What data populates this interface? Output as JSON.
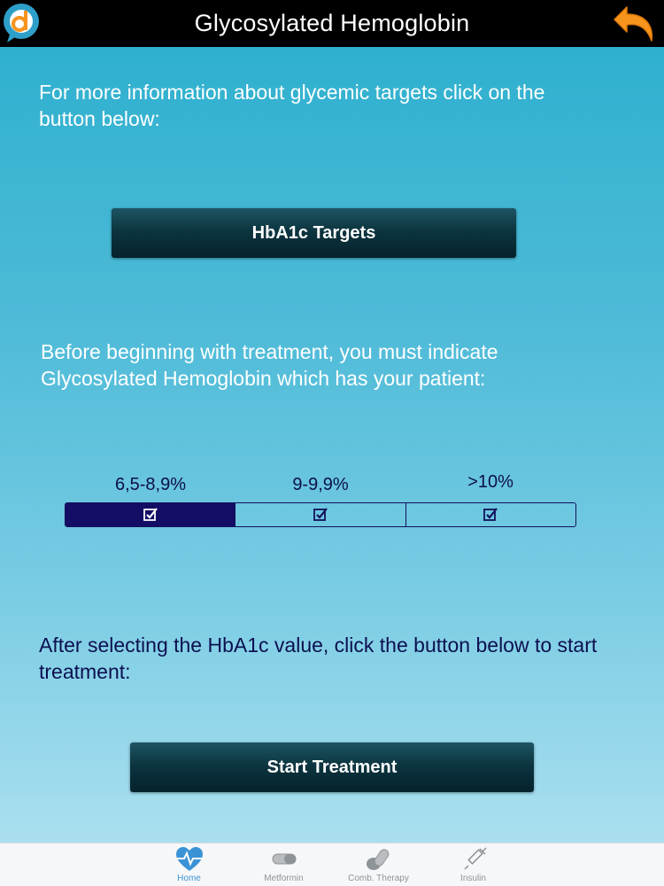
{
  "header": {
    "title": "Glycosylated Hemoglobin",
    "logo_icon": "app-logo-d-icon",
    "back_icon": "back-arrow-icon"
  },
  "intro": {
    "text": "For more information about glycemic targets click on the button below:"
  },
  "targets_button": {
    "label": "HbA1c Targets"
  },
  "before": {
    "text": "Before beginning with treatment, you must indicate Glycosylated Hemoglobin which has your patient:"
  },
  "hba1c_selector": {
    "options": [
      "6,5-8,9%",
      "9-9,9%",
      ">10%"
    ],
    "selected_index": 0,
    "check_icon": "checkbox-icon"
  },
  "after": {
    "text": "After selecting the HbA1c value, click the button below to start treatment:"
  },
  "start_button": {
    "label": "Start Treatment"
  },
  "tabs": [
    {
      "label": "Home",
      "icon": "heart-pulse-icon",
      "active": true
    },
    {
      "label": "Metformin",
      "icon": "pill-icon",
      "active": false
    },
    {
      "label": "Comb. Therapy",
      "icon": "pills-icon",
      "active": false
    },
    {
      "label": "Insulin",
      "icon": "syringe-icon",
      "active": false
    }
  ],
  "colors": {
    "header_bg": "#000000",
    "accent_orange": "#f7941d",
    "selected_segment": "#140d66",
    "tab_active": "#3b93d6"
  }
}
